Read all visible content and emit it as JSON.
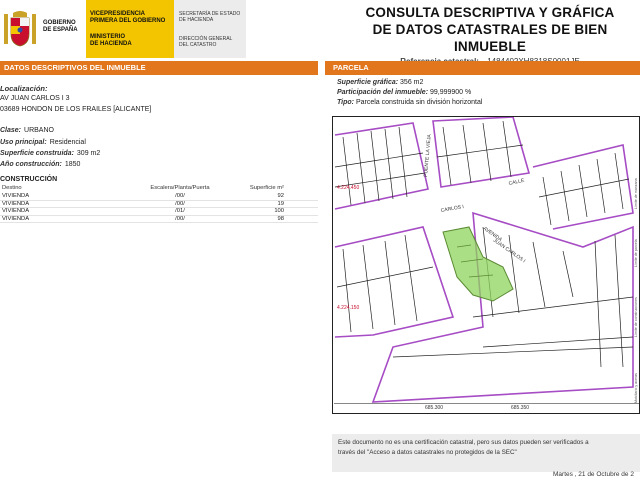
{
  "header": {
    "gov_line1": "GOBIERNO",
    "gov_line2": "DE ESPAÑA",
    "vice_line1": "VICEPRESIDENCIA",
    "vice_line2": "PRIMERA DEL GOBIERNO",
    "min_line1": "MINISTERIO",
    "min_line2": "DE HACIENDA",
    "sec_line1": "SECRETARÍA DE ESTADO",
    "sec_line2": "DE HACIENDA",
    "dir_line1": "DIRECCIÓN GENERAL",
    "dir_line2": "DEL CATASTRO",
    "title_line1": "CONSULTA DESCRIPTIVA Y GRÁFICA",
    "title_line2": "DE DATOS CATASTRALES DE BIEN INMUEBLE",
    "ref_label": "Referencia catastral:",
    "ref_value": "1484402XH8318S0001JE"
  },
  "left": {
    "section_title": "DATOS DESCRIPTIVOS DEL INMUEBLE",
    "loc_label": "Localización:",
    "loc_line1": "AV JUAN CARLOS I 3",
    "loc_line2": "03689 HONDON DE LOS FRAILES [ALICANTE]",
    "clase_label": "Clase:",
    "clase_value": "URBANO",
    "uso_label": "Uso principal:",
    "uso_value": "Residencial",
    "sup_label": "Superficie construida:",
    "sup_value": "309 m2",
    "anio_label": "Año construcción:",
    "anio_value": "1850",
    "construccion_title": "CONSTRUCCIÓN",
    "table_headers": [
      "Destino",
      "Escalera/Planta/Puerta",
      "Superficie m²"
    ],
    "table_rows": [
      [
        "VIVIENDA",
        "/00/",
        "92"
      ],
      [
        "VIVIENDA",
        "/00/",
        "19"
      ],
      [
        "VIVIENDA",
        "/01/",
        "100"
      ],
      [
        "VIVIENDA",
        "/00/",
        "98"
      ]
    ]
  },
  "right": {
    "section_title": "PARCELA",
    "sup_graf_label": "Superficie gráfica:",
    "sup_graf_value": "356 m2",
    "part_label": "Participación del inmueble:",
    "part_value": "99,999900 %",
    "tipo_label": "Tipo:",
    "tipo_value": "Parcela construida sin división horizontal"
  },
  "map": {
    "street_labels": [
      "PUENTE LA VIEJA",
      "CALLE",
      "CARLOS I",
      "AVENIDA",
      "JUAN CARLOS I"
    ],
    "coord_labels": [
      "4.224.450",
      "4.224.150",
      "685.300",
      "685.350"
    ],
    "side_labels": [
      "Límite de manzana",
      "Límite de parcela",
      "Límite de construcciones",
      "Mobiliario y aceras"
    ]
  },
  "notice": {
    "line1": "Este documento no es una certificación catastral, pero sus datos pueden ser verificados a",
    "line2": "través del \"Acceso a datos catastrales no protegidos de la SEC\""
  },
  "date_text": "Martes , 21 de Octubre de 2",
  "colors": {
    "orange": "#e1761d",
    "yellow": "#f2c500",
    "parcel_green": "#8fd45c",
    "outline_purple": "#a64cc4"
  }
}
